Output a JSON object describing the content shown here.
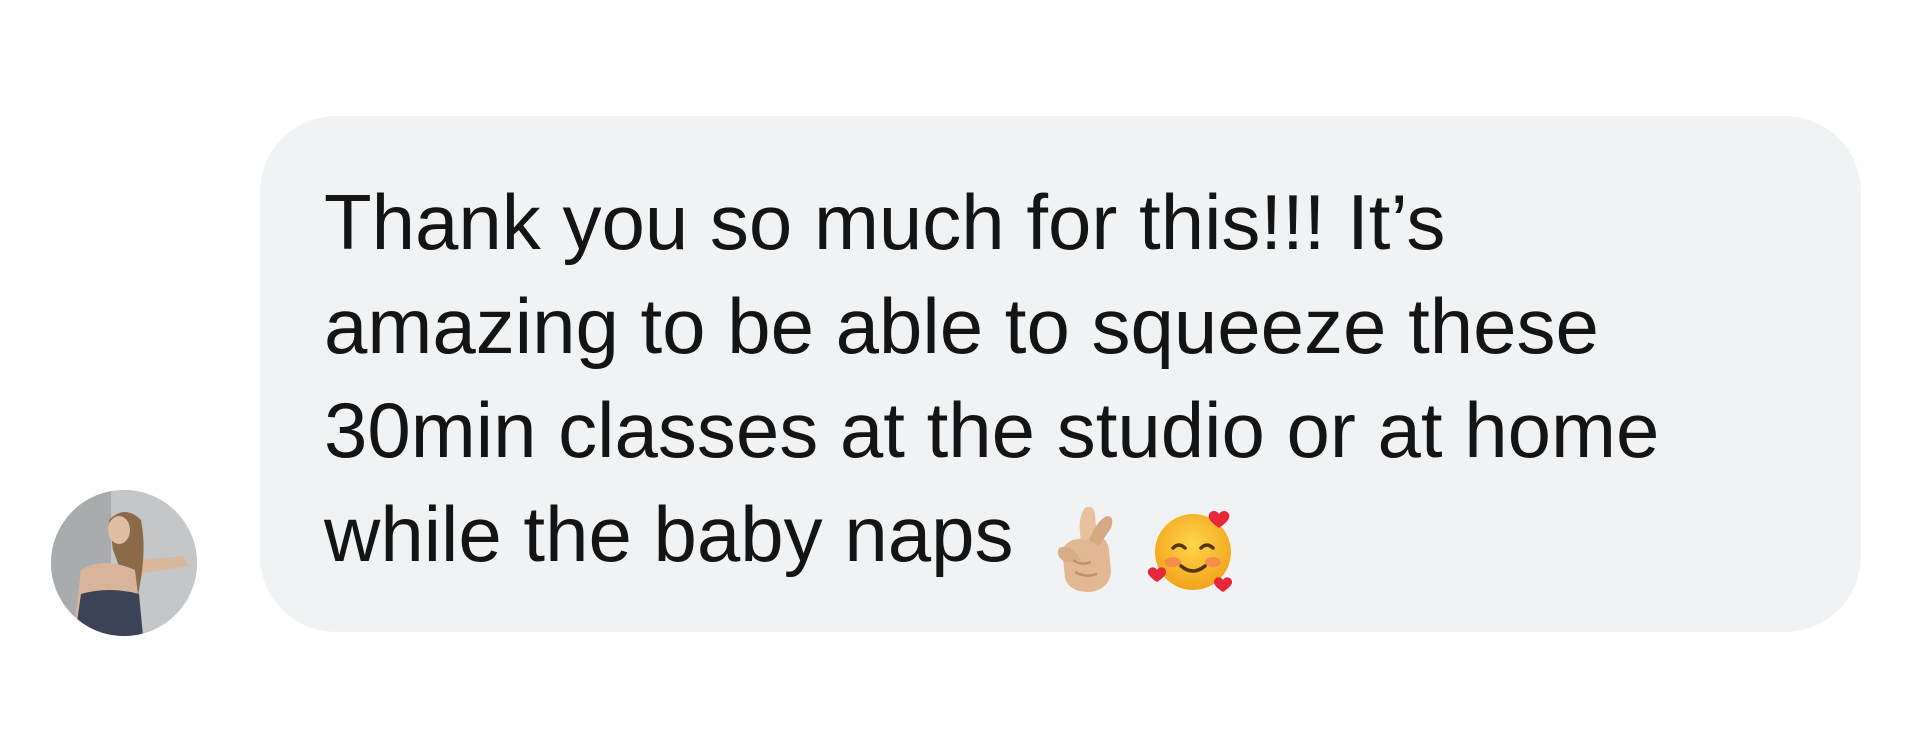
{
  "message": {
    "sender_avatar": "profile-photo",
    "lines": [
      "Thank you so much for this!!! It’s",
      "amazing to be able to squeeze these",
      "30min classes at the studio or at home",
      "while the baby naps"
    ],
    "emojis": [
      {
        "icon": "crossed-fingers-emoji",
        "char": "🤞🏼"
      },
      {
        "icon": "smiling-face-with-hearts-emoji",
        "char": "🥰"
      }
    ]
  },
  "colors": {
    "bubble": "#f1f2f4",
    "text": "#141414",
    "background": "#ffffff"
  }
}
